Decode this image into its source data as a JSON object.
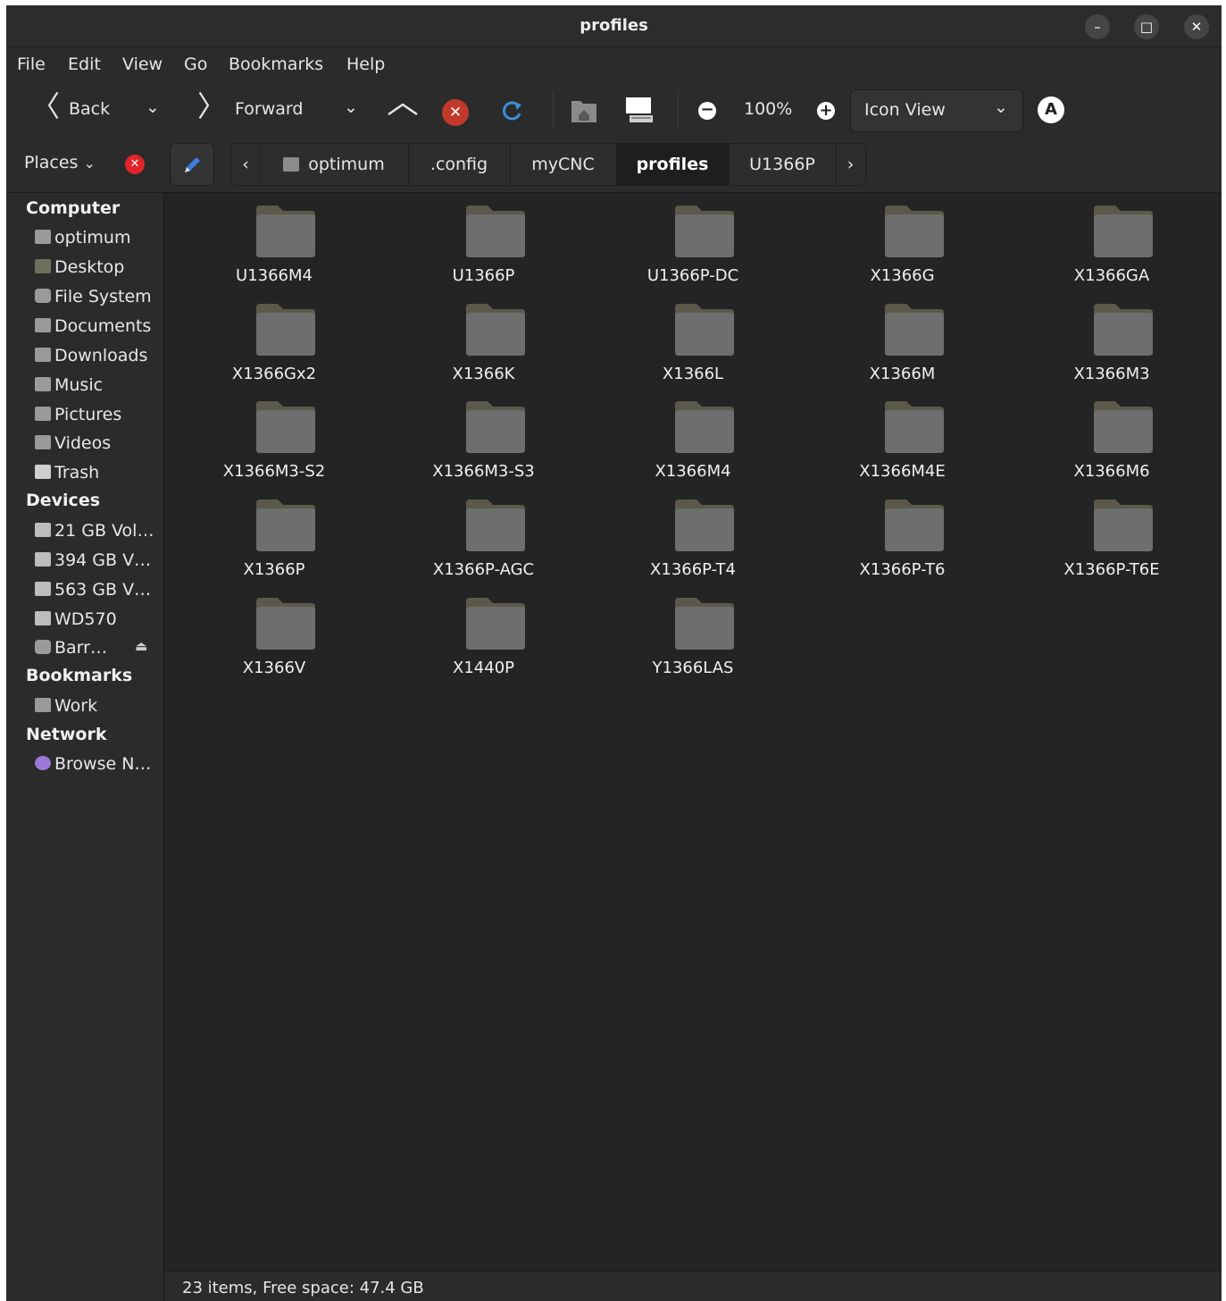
{
  "window": {
    "title": "profiles"
  },
  "menubar": {
    "items": [
      "File",
      "Edit",
      "View",
      "Go",
      "Bookmarks",
      "Help"
    ]
  },
  "toolbar": {
    "back_label": "Back",
    "forward_label": "Forward",
    "zoom_level": "100%",
    "view_mode": "Icon View"
  },
  "location": {
    "places_label": "Places",
    "breadcrumbs": [
      "optimum",
      ".config",
      "myCNC",
      "profiles",
      "U1366P"
    ],
    "active_crumb": "profiles"
  },
  "sidebar": {
    "sections": [
      {
        "heading": "Computer",
        "items": [
          {
            "label": "optimum",
            "icon": "home-folder-icon"
          },
          {
            "label": "Desktop",
            "icon": "desktop-folder-icon"
          },
          {
            "label": "File System",
            "icon": "disk-icon"
          },
          {
            "label": "Documents",
            "icon": "documents-folder-icon"
          },
          {
            "label": "Downloads",
            "icon": "downloads-folder-icon"
          },
          {
            "label": "Music",
            "icon": "music-folder-icon"
          },
          {
            "label": "Pictures",
            "icon": "pictures-folder-icon"
          },
          {
            "label": "Videos",
            "icon": "videos-folder-icon"
          },
          {
            "label": "Trash",
            "icon": "trash-icon"
          }
        ]
      },
      {
        "heading": "Devices",
        "items": [
          {
            "label": "21 GB Vol…",
            "icon": "drive-icon"
          },
          {
            "label": "394 GB V…",
            "icon": "drive-icon"
          },
          {
            "label": "563 GB V…",
            "icon": "drive-icon"
          },
          {
            "label": "WD570",
            "icon": "drive-icon"
          },
          {
            "label": "Barr…",
            "icon": "disc-icon"
          }
        ]
      },
      {
        "heading": "Bookmarks",
        "items": [
          {
            "label": "Work",
            "icon": "folder-icon"
          }
        ]
      },
      {
        "heading": "Network",
        "items": [
          {
            "label": "Browse N…",
            "icon": "network-icon"
          }
        ]
      }
    ]
  },
  "folders": [
    "U1366M4",
    "U1366P",
    "U1366P-DC",
    "X1366G",
    "X1366GA",
    "X1366Gx2",
    "X1366K",
    "X1366L",
    "X1366M",
    "X1366M3",
    "X1366M3-S2",
    "X1366M3-S3",
    "X1366M4",
    "X1366M4E",
    "X1366M6",
    "X1366P",
    "X1366P-AGC",
    "X1366P-T4",
    "X1366P-T6",
    "X1366P-T6E",
    "X1366V",
    "X1440P",
    "Y1366LAS"
  ],
  "status": {
    "text": "23 items, Free space: 47.4 GB"
  },
  "colors": {
    "background": "#242424",
    "chrome": "#2b2b2b",
    "folder": "#6e6e6e",
    "folder_tab": "#5b5a4a",
    "stop_red": "#c0392b",
    "reload_blue": "#3d8fd8"
  }
}
